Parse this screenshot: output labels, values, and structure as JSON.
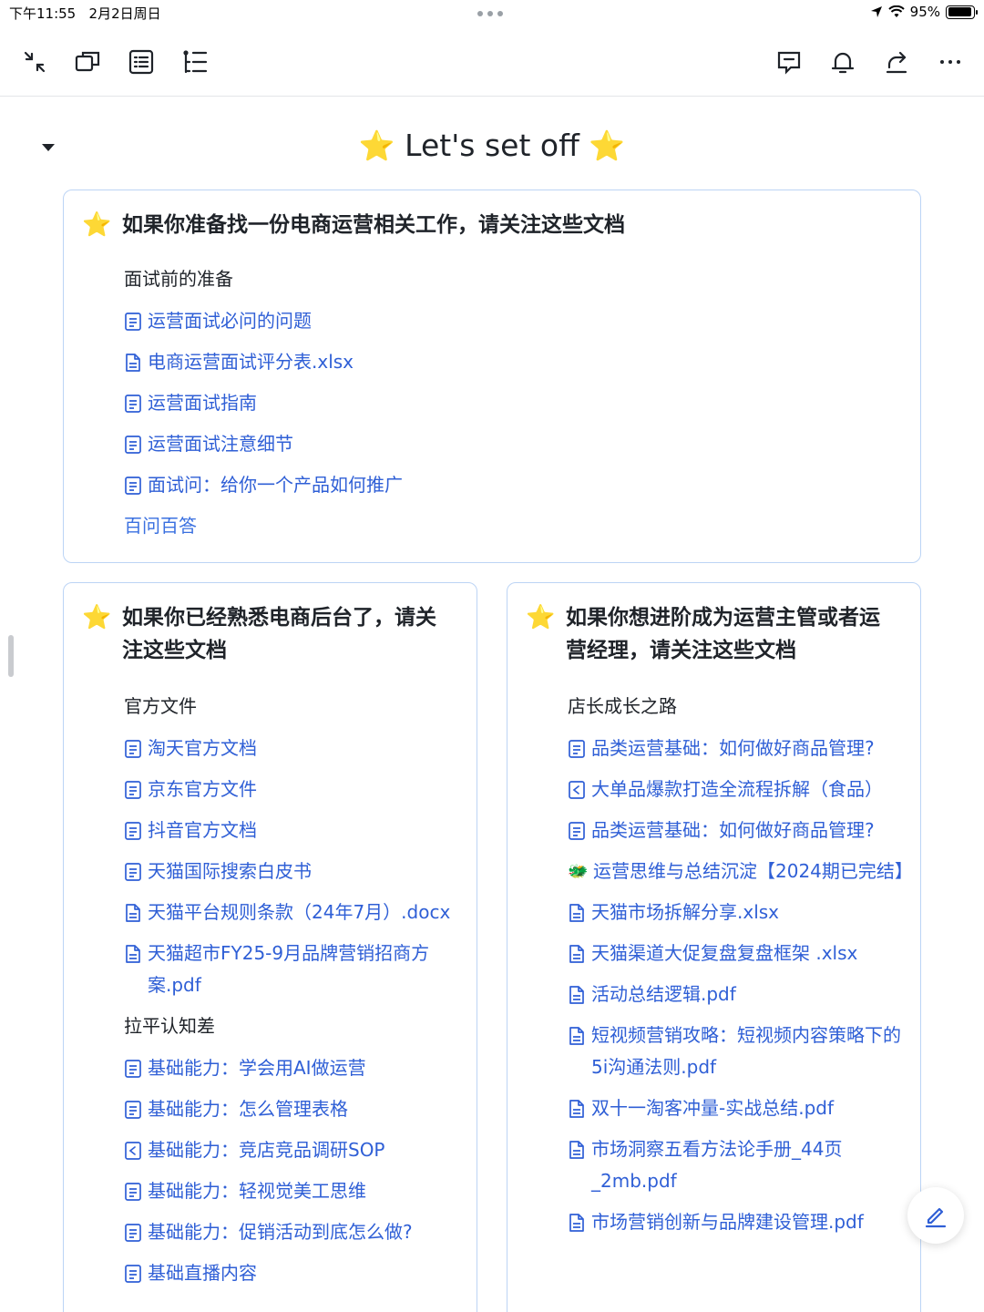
{
  "status_bar": {
    "time": "下午11:55",
    "date": "2月2日周日",
    "battery": "95%",
    "battery_level": 0.95
  },
  "toolbar": {
    "left_icons": [
      "collapse-icon",
      "window-icon",
      "outline-icon",
      "tree-list-icon"
    ],
    "right_icons": [
      "comment-icon",
      "bell-icon",
      "share-icon",
      "more-icon"
    ]
  },
  "page": {
    "title": "Let's set off",
    "title_star": "⭐"
  },
  "card_top": {
    "heading": "如果你准备找一份电商运营相关工作，请关注这些文档",
    "sections": [
      {
        "title": "面试前的准备",
        "links": [
          {
            "icon": "doc-icon",
            "text": "运营面试必问的问题"
          },
          {
            "icon": "sheet-file-icon",
            "text": "电商运营面试评分表.xlsx"
          },
          {
            "icon": "doc-icon",
            "text": "运营面试指南"
          },
          {
            "icon": "doc-icon",
            "text": "运营面试注意细节"
          },
          {
            "icon": "doc-icon",
            "text": "面试问：给你一个产品如何推广"
          }
        ],
        "extra_link": "百问百答"
      }
    ]
  },
  "card_left": {
    "heading": "如果你已经熟悉电商后台了，请关注这些文档",
    "sections": [
      {
        "title": "官方文件",
        "links": [
          {
            "icon": "doc-icon",
            "text": "淘天官方文档"
          },
          {
            "icon": "doc-icon",
            "text": "京东官方文件"
          },
          {
            "icon": "doc-icon",
            "text": "抖音官方文档"
          },
          {
            "icon": "doc-icon",
            "text": "天猫国际搜索白皮书"
          },
          {
            "icon": "file-icon",
            "text": "天猫平台规则条款（24年7月）.docx"
          },
          {
            "icon": "file-icon",
            "text": "天猫超市FY25-9月品牌营销招商方案.pdf"
          }
        ]
      },
      {
        "title": "拉平认知差",
        "links": [
          {
            "icon": "doc-icon",
            "text": "基础能力：学会用AI做运营"
          },
          {
            "icon": "doc-icon",
            "text": "基础能力：怎么管理表格"
          },
          {
            "icon": "slides-icon",
            "text": "基础能力：竞店竞品调研SOP"
          },
          {
            "icon": "doc-icon",
            "text": "基础能力：轻视觉美工思维"
          },
          {
            "icon": "doc-icon",
            "text": "基础能力：促销活动到底怎么做?"
          },
          {
            "icon": "doc-icon",
            "text": "基础直播内容"
          }
        ]
      }
    ]
  },
  "card_right": {
    "heading": "如果你想进阶成为运营主管或者运营经理，请关注这些文档",
    "sections": [
      {
        "title": "店长成长之路",
        "links": [
          {
            "icon": "doc-icon",
            "text": "品类运营基础：如何做好商品管理?"
          },
          {
            "icon": "slides-icon",
            "text": "大单品爆款打造全流程拆解（食品）"
          },
          {
            "icon": "doc-icon",
            "text": "品类运营基础：如何做好商品管理?"
          },
          {
            "icon": "dragon-emoji-icon",
            "emoji": "🐲",
            "text": "运营思维与总结沉淀【2024期已完结】"
          },
          {
            "icon": "file-icon",
            "text": "天猫市场拆解分享.xlsx"
          },
          {
            "icon": "file-icon",
            "text": "天猫渠道大促复盘复盘框架 .xlsx"
          },
          {
            "icon": "file-icon",
            "text": "活动总结逻辑.pdf"
          },
          {
            "icon": "file-icon",
            "text": "短视频营销攻略：短视频内容策略下的5i沟通法则.pdf"
          },
          {
            "icon": "file-icon",
            "text": "双十一淘客冲量-实战总结.pdf"
          },
          {
            "icon": "file-icon",
            "text": "市场洞察五看方法论手册_44页_2mb.pdf"
          },
          {
            "icon": "file-icon",
            "text": "市场营销创新与品牌建设管理.pdf"
          }
        ]
      }
    ]
  },
  "colors": {
    "link": "#2f5fd6",
    "card_border": "#bcd4f5",
    "text": "#1f2329"
  }
}
